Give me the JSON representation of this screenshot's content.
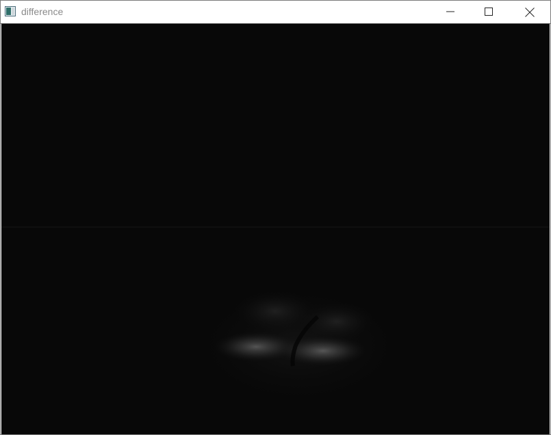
{
  "window": {
    "title": "difference",
    "app_icon": "opencv-window-icon",
    "controls": {
      "minimize_icon": "minimize-icon",
      "maximize_icon": "maximize-icon",
      "close_icon": "close-icon"
    }
  },
  "image": {
    "description_label": "",
    "background_color": "#080808",
    "highlight_color": "#9a9a9a"
  }
}
